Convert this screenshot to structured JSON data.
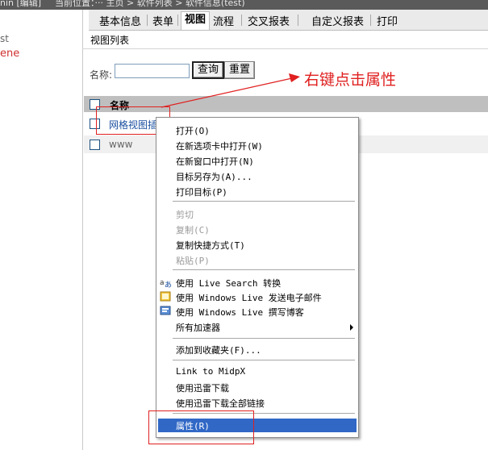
{
  "topbar": {
    "left_text": "nin [编辑]",
    "right_text": "当前位置：··· 主页 > 软件列表 > 软件信息(test)"
  },
  "left_panel": {
    "text1": "st",
    "text2": "ene"
  },
  "tabs": [
    {
      "label": "基本信息",
      "active": false
    },
    {
      "label": "表单",
      "active": false
    },
    {
      "label": "视图",
      "active": true
    },
    {
      "label": "流程",
      "active": false
    },
    {
      "label": "交叉报表",
      "active": false
    },
    {
      "label": "自定义报表",
      "active": false
    },
    {
      "label": "打印",
      "active": false
    }
  ],
  "subtitle": "视图列表",
  "search": {
    "label": "名称:",
    "value": "",
    "query_button": "查询",
    "reset_button": "重置"
  },
  "table": {
    "header": "名称",
    "rows": [
      {
        "name": "网格视图插"
      },
      {
        "name": "www"
      }
    ]
  },
  "annotation": "右键点击属性",
  "context_menu": {
    "items": [
      {
        "label": "打开(O)",
        "disabled": false
      },
      {
        "label": "在新选项卡中打开(W)",
        "disabled": false
      },
      {
        "label": "在新窗口中打开(N)",
        "disabled": false
      },
      {
        "label": "目标另存为(A)...",
        "disabled": false
      },
      {
        "label": "打印目标(P)",
        "disabled": false
      },
      {
        "label": "剪切",
        "disabled": true
      },
      {
        "label": "复制(C)",
        "disabled": true
      },
      {
        "label": "复制快捷方式(T)",
        "disabled": false
      },
      {
        "label": "粘贴(P)",
        "disabled": true
      },
      {
        "label": "使用 Live Search 转换",
        "disabled": false,
        "icon": "translate-icon"
      },
      {
        "label": "使用 Windows Live 发送电子邮件",
        "disabled": false,
        "icon": "email-icon"
      },
      {
        "label": "使用 Windows Live 撰写博客",
        "disabled": false,
        "icon": "blog-icon"
      },
      {
        "label": "所有加速器",
        "disabled": false,
        "submenu": true
      },
      {
        "label": "添加到收藏夹(F)...",
        "disabled": false
      },
      {
        "label": "Link to MidpX",
        "disabled": false
      },
      {
        "label": "使用迅雷下载",
        "disabled": false
      },
      {
        "label": "使用迅雷下载全部链接",
        "disabled": false
      },
      {
        "label": "属性(R)",
        "disabled": false,
        "highlighted": true
      }
    ]
  },
  "colors": {
    "accent_red": "#e02020",
    "menu_highlight": "#3168c6",
    "link": "#1a4fa0"
  }
}
